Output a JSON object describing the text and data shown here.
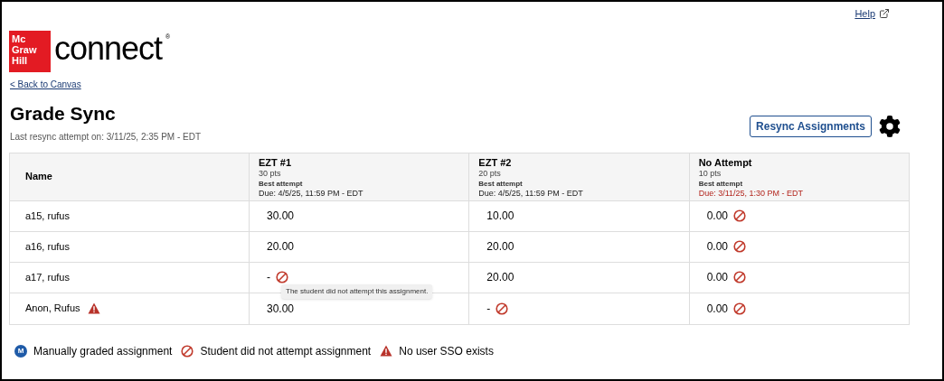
{
  "help_link": "Help",
  "logo": {
    "mark_lines": [
      "Mc",
      "Graw",
      "Hill"
    ],
    "wordmark": "connect",
    "registered": "®"
  },
  "back_link": "< Back to Canvas",
  "title": "Grade Sync",
  "last_resync": "Last resync attempt on: 3/11/25, 2:35 PM - EDT",
  "resync_button": "Resync Assignments",
  "table": {
    "name_column": "Name",
    "columns": [
      {
        "title": "EZT #1",
        "points": "30 pts",
        "attempt": "Best attempt",
        "due": "Due: 4/5/25, 11:59 PM - EDT",
        "overdue": false
      },
      {
        "title": "EZT #2",
        "points": "20 pts",
        "attempt": "Best attempt",
        "due": "Due: 4/5/25, 11:59 PM - EDT",
        "overdue": false
      },
      {
        "title": "No Attempt",
        "points": "10 pts",
        "attempt": "Best attempt",
        "due": "Due: 3/11/25, 1:30 PM - EDT",
        "overdue": true
      }
    ],
    "rows": [
      {
        "name": "a15, rufus",
        "no_sso": false,
        "cells": [
          {
            "score": "30.00",
            "no_attempt": false
          },
          {
            "score": "10.00",
            "no_attempt": false
          },
          {
            "score": "0.00",
            "no_attempt": true
          }
        ]
      },
      {
        "name": "a16, rufus",
        "no_sso": false,
        "cells": [
          {
            "score": "20.00",
            "no_attempt": false
          },
          {
            "score": "20.00",
            "no_attempt": false
          },
          {
            "score": "0.00",
            "no_attempt": true
          }
        ]
      },
      {
        "name": "a17, rufus",
        "no_sso": false,
        "cells": [
          {
            "score": "-",
            "no_attempt": true,
            "tooltip": "The student did not attempt this assignment."
          },
          {
            "score": "20.00",
            "no_attempt": false
          },
          {
            "score": "0.00",
            "no_attempt": true
          }
        ]
      },
      {
        "name": "Anon, Rufus",
        "no_sso": true,
        "cells": [
          {
            "score": "30.00",
            "no_attempt": false
          },
          {
            "score": "-",
            "no_attempt": true
          },
          {
            "score": "0.00",
            "no_attempt": true
          }
        ]
      }
    ]
  },
  "legend": [
    {
      "kind": "manual",
      "icon_text": "M",
      "label": "Manually graded assignment"
    },
    {
      "kind": "no_attempt",
      "label": "Student did not attempt assignment"
    },
    {
      "kind": "no_sso",
      "label": "No user SSO exists"
    }
  ]
}
